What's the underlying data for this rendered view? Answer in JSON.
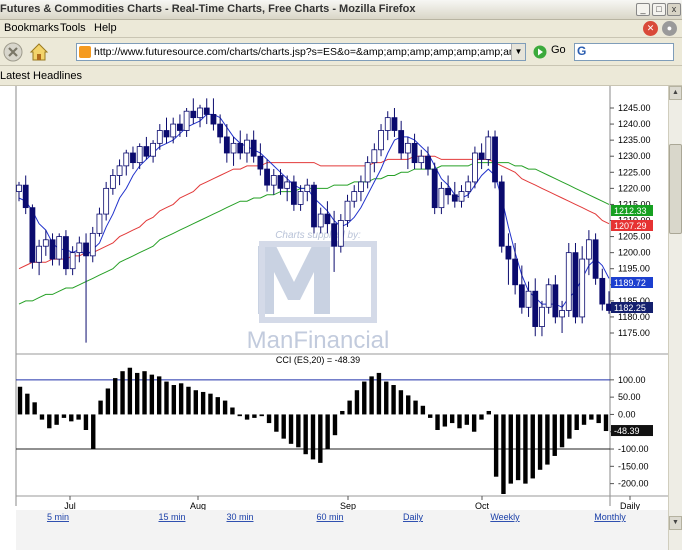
{
  "window": {
    "title": "Futures & Commodities Charts - Real-Time Charts, Free Charts - Mozilla Firefox",
    "min_glyph": "_",
    "max_glyph": "□",
    "close_glyph": "x"
  },
  "menu": {
    "items": [
      "Bookmarks",
      "Tools",
      "Help"
    ]
  },
  "nav": {
    "url": "http://www.futuresource.com/charts/charts.jsp?s=ES&o=&amp;amp;amp;amp;amp;amp;amp;amp;a=D&",
    "go_label": "Go",
    "search_glyph": "G"
  },
  "bookmarks": {
    "latest_headlines": "Latest Headlines"
  },
  "colors": {
    "candle": "#0b0b6e",
    "ma5": "#2233cc",
    "ma_red": "#e23a3a",
    "ma_green": "#26a026",
    "badge_green": "#16a021",
    "badge_red": "#e63232",
    "badge_blue": "#1c3fcf",
    "badge_navy": "#14206e"
  },
  "chart_data": [
    {
      "type": "candlestick",
      "ylim": [
        1170,
        1250
      ],
      "yticks": [
        "1245.00",
        "1240.00",
        "1235.00",
        "1230.00",
        "1225.00",
        "1220.00",
        "1215.00",
        "1210.00",
        "1205.00",
        "1200.00",
        "1195.00",
        "1190.00",
        "1185.00",
        "1180.00",
        "1175.00"
      ],
      "watermark": {
        "top": "Charts supplied by:",
        "brand": "ManFinancial"
      },
      "price_badges": [
        {
          "label": "1212.33",
          "color": "#16a021"
        },
        {
          "label": "1207.29",
          "color": "#e63232"
        },
        {
          "label": "1189.72",
          "color": "#1c3fcf"
        },
        {
          "label": "1182.25",
          "color": "#14206e"
        }
      ],
      "ohlc": [
        [
          1219,
          1222,
          1216,
          1221
        ],
        [
          1221,
          1224,
          1212,
          1214
        ],
        [
          1214,
          1215,
          1195,
          1197
        ],
        [
          1197,
          1204,
          1193,
          1202
        ],
        [
          1202,
          1207,
          1199,
          1204
        ],
        [
          1204,
          1206,
          1196,
          1198
        ],
        [
          1198,
          1206,
          1196,
          1205
        ],
        [
          1205,
          1207,
          1193,
          1195
        ],
        [
          1195,
          1202,
          1193,
          1200
        ],
        [
          1200,
          1205,
          1197,
          1203
        ],
        [
          1203,
          1206,
          1172,
          1199
        ],
        [
          1199,
          1208,
          1197,
          1206
        ],
        [
          1206,
          1214,
          1205,
          1212
        ],
        [
          1212,
          1222,
          1210,
          1220
        ],
        [
          1220,
          1226,
          1218,
          1224
        ],
        [
          1224,
          1229,
          1221,
          1227
        ],
        [
          1227,
          1232,
          1224,
          1231
        ],
        [
          1231,
          1233,
          1226,
          1228
        ],
        [
          1228,
          1234,
          1226,
          1233
        ],
        [
          1233,
          1236,
          1229,
          1230
        ],
        [
          1230,
          1235,
          1228,
          1234
        ],
        [
          1234,
          1240,
          1232,
          1238
        ],
        [
          1238,
          1242,
          1234,
          1236
        ],
        [
          1236,
          1242,
          1234,
          1240
        ],
        [
          1240,
          1243,
          1236,
          1238
        ],
        [
          1238,
          1245,
          1236,
          1244
        ],
        [
          1244,
          1248,
          1240,
          1242
        ],
        [
          1242,
          1246,
          1239,
          1245
        ],
        [
          1245,
          1248,
          1240,
          1243
        ],
        [
          1243,
          1248,
          1238,
          1240
        ],
        [
          1240,
          1243,
          1234,
          1236
        ],
        [
          1236,
          1240,
          1228,
          1231
        ],
        [
          1231,
          1236,
          1227,
          1234
        ],
        [
          1234,
          1238,
          1229,
          1231
        ],
        [
          1231,
          1237,
          1228,
          1235
        ],
        [
          1235,
          1238,
          1228,
          1230
        ],
        [
          1230,
          1234,
          1224,
          1226
        ],
        [
          1226,
          1229,
          1219,
          1221
        ],
        [
          1221,
          1226,
          1218,
          1224
        ],
        [
          1224,
          1226,
          1218,
          1220
        ],
        [
          1220,
          1224,
          1216,
          1222
        ],
        [
          1222,
          1224,
          1213,
          1215
        ],
        [
          1215,
          1221,
          1213,
          1219
        ],
        [
          1219,
          1223,
          1216,
          1221
        ],
        [
          1221,
          1222,
          1206,
          1208
        ],
        [
          1208,
          1214,
          1206,
          1212
        ],
        [
          1212,
          1216,
          1206,
          1209
        ],
        [
          1209,
          1213,
          1194,
          1202
        ],
        [
          1202,
          1212,
          1200,
          1210
        ],
        [
          1210,
          1218,
          1208,
          1216
        ],
        [
          1216,
          1221,
          1214,
          1219
        ],
        [
          1219,
          1224,
          1216,
          1222
        ],
        [
          1222,
          1230,
          1220,
          1228
        ],
        [
          1228,
          1234,
          1225,
          1232
        ],
        [
          1232,
          1240,
          1230,
          1238
        ],
        [
          1238,
          1244,
          1235,
          1242
        ],
        [
          1242,
          1245,
          1236,
          1238
        ],
        [
          1238,
          1241,
          1229,
          1231
        ],
        [
          1231,
          1236,
          1226,
          1234
        ],
        [
          1234,
          1237,
          1226,
          1228
        ],
        [
          1228,
          1232,
          1226,
          1230
        ],
        [
          1230,
          1233,
          1224,
          1226
        ],
        [
          1226,
          1228,
          1212,
          1214
        ],
        [
          1214,
          1222,
          1212,
          1220
        ],
        [
          1220,
          1224,
          1215,
          1218
        ],
        [
          1218,
          1222,
          1214,
          1216
        ],
        [
          1216,
          1221,
          1214,
          1219
        ],
        [
          1219,
          1224,
          1217,
          1222
        ],
        [
          1222,
          1233,
          1220,
          1231
        ],
        [
          1231,
          1234,
          1226,
          1229
        ],
        [
          1229,
          1238,
          1227,
          1236
        ],
        [
          1236,
          1238,
          1220,
          1222
        ],
        [
          1222,
          1224,
          1200,
          1202
        ],
        [
          1202,
          1206,
          1190,
          1198
        ],
        [
          1198,
          1203,
          1187,
          1190
        ],
        [
          1190,
          1196,
          1181,
          1183
        ],
        [
          1183,
          1191,
          1180,
          1188
        ],
        [
          1188,
          1192,
          1174,
          1177
        ],
        [
          1177,
          1185,
          1174,
          1183
        ],
        [
          1183,
          1192,
          1181,
          1190
        ],
        [
          1190,
          1193,
          1178,
          1180
        ],
        [
          1180,
          1185,
          1175,
          1182
        ],
        [
          1182,
          1203,
          1180,
          1200
        ],
        [
          1200,
          1203,
          1178,
          1180
        ],
        [
          1180,
          1202,
          1178,
          1198
        ],
        [
          1198,
          1207,
          1193,
          1204
        ],
        [
          1204,
          1206,
          1190,
          1192
        ],
        [
          1192,
          1195,
          1182,
          1184
        ],
        [
          1184,
          1188,
          1181,
          1182
        ]
      ],
      "ma_fast": [
        1217,
        1216,
        1213,
        1209,
        1207,
        1203,
        1201,
        1201,
        1200,
        1201,
        1199,
        1201,
        1203,
        1208,
        1212,
        1217,
        1220,
        1224,
        1227,
        1229,
        1231,
        1233,
        1234,
        1235,
        1237,
        1239,
        1240,
        1241,
        1243,
        1243,
        1242,
        1239,
        1236,
        1234,
        1233,
        1232,
        1231,
        1229,
        1227,
        1225,
        1223,
        1221,
        1220,
        1220,
        1217,
        1215,
        1213,
        1210,
        1208,
        1209,
        1211,
        1214,
        1218,
        1222,
        1226,
        1231,
        1235,
        1236,
        1236,
        1235,
        1233,
        1231,
        1227,
        1223,
        1221,
        1218,
        1217,
        1218,
        1221,
        1224,
        1226,
        1224,
        1217,
        1208,
        1200,
        1193,
        1188,
        1186,
        1184,
        1184,
        1184,
        1183,
        1186,
        1188,
        1192,
        1196,
        1198,
        1196,
        1192
      ],
      "ma_red": [
        1195,
        1196,
        1197,
        1197,
        1197,
        1198,
        1198,
        1198,
        1199,
        1199,
        1200,
        1200,
        1201,
        1202,
        1203,
        1205,
        1206,
        1207,
        1208,
        1210,
        1211,
        1213,
        1214,
        1215,
        1217,
        1218,
        1219,
        1221,
        1222,
        1223,
        1224,
        1225,
        1226,
        1226,
        1227,
        1227,
        1227,
        1228,
        1228,
        1228,
        1228,
        1228,
        1228,
        1228,
        1228,
        1227,
        1227,
        1227,
        1227,
        1227,
        1227,
        1227,
        1227,
        1228,
        1228,
        1229,
        1229,
        1229,
        1229,
        1230,
        1230,
        1230,
        1230,
        1229,
        1229,
        1229,
        1229,
        1229,
        1229,
        1229,
        1229,
        1228,
        1227,
        1226,
        1225,
        1223,
        1222,
        1221,
        1220,
        1219,
        1218,
        1217,
        1216,
        1215,
        1214,
        1213,
        1212,
        1210,
        1209
      ],
      "ma_green": [
        1184,
        1185,
        1185,
        1186,
        1187,
        1187,
        1188,
        1189,
        1189,
        1190,
        1191,
        1192,
        1193,
        1194,
        1195,
        1197,
        1198,
        1199,
        1200,
        1201,
        1202,
        1204,
        1205,
        1206,
        1207,
        1208,
        1209,
        1210,
        1211,
        1212,
        1213,
        1214,
        1215,
        1216,
        1216,
        1217,
        1217,
        1218,
        1218,
        1219,
        1219,
        1219,
        1220,
        1220,
        1220,
        1220,
        1220,
        1221,
        1221,
        1221,
        1222,
        1222,
        1222,
        1223,
        1223,
        1224,
        1224,
        1225,
        1225,
        1226,
        1226,
        1226,
        1226,
        1227,
        1227,
        1227,
        1227,
        1227,
        1228,
        1228,
        1228,
        1228,
        1228,
        1228,
        1227,
        1227,
        1226,
        1226,
        1225,
        1224,
        1223,
        1222,
        1221,
        1220,
        1219,
        1218,
        1217,
        1216,
        1215
      ]
    },
    {
      "type": "bar",
      "title": "CCI (ES,20) = -48.39",
      "ylim": [
        -230,
        140
      ],
      "reference_lines": [
        100,
        -100
      ],
      "yticks": [
        "100.00",
        "50.00",
        "0.00",
        "-50.00",
        "-100.00",
        "-150.00",
        "-200.00"
      ],
      "last_value_badge": "-48.39",
      "values": [
        80,
        60,
        35,
        -15,
        -40,
        -30,
        -10,
        -20,
        -15,
        -45,
        -100,
        40,
        75,
        105,
        125,
        135,
        120,
        125,
        115,
        110,
        95,
        85,
        90,
        80,
        70,
        65,
        60,
        50,
        40,
        20,
        -5,
        -15,
        -10,
        -5,
        -25,
        -50,
        -70,
        -85,
        -95,
        -115,
        -130,
        -140,
        -100,
        -60,
        10,
        40,
        70,
        95,
        110,
        120,
        95,
        85,
        70,
        55,
        40,
        25,
        -10,
        -45,
        -35,
        -25,
        -40,
        -30,
        -50,
        -15,
        10,
        -180,
        -230,
        -200,
        -190,
        -200,
        -185,
        -160,
        -145,
        -120,
        -95,
        -70,
        -45,
        -30,
        -15,
        -25,
        -48
      ],
      "xticks": [
        "Jul",
        "Aug",
        "Sep",
        "Oct",
        "Daily"
      ]
    }
  ],
  "timeframes": [
    "5 min",
    "15 min",
    "30 min",
    "60 min",
    "Daily",
    "Weekly",
    "Monthly"
  ]
}
